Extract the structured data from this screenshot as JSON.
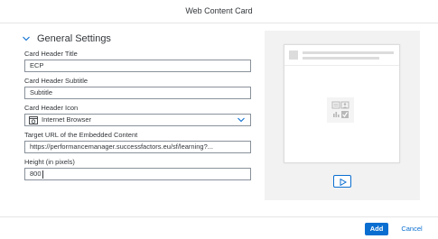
{
  "dialog": {
    "title": "Web Content Card"
  },
  "section": {
    "title": "General Settings",
    "icon": "chevron-down-icon"
  },
  "fields": {
    "header_title": {
      "label": "Card Header Title",
      "value": "ECP"
    },
    "header_subtitle": {
      "label": "Card Header Subtitle",
      "value": "Subtitle"
    },
    "header_icon": {
      "label": "Card Header Icon",
      "value": "Internet Browser",
      "icon": "internet-browser-icon"
    },
    "target_url": {
      "label": "Target URL of the Embedded Content",
      "value": "https://performancemanager.successfactors.eu/sf/learning?..."
    },
    "height": {
      "label": "Height (in pixels)",
      "value": "800"
    }
  },
  "preview": {
    "play_icon": "play-icon",
    "placeholder_icon": "content-placeholder-icon"
  },
  "footer": {
    "add_label": "Add",
    "cancel_label": "Cancel"
  },
  "colors": {
    "accent": "#0a6ed1",
    "text": "#32363a",
    "border": "#89919a",
    "panel": "#f2f2f2"
  }
}
